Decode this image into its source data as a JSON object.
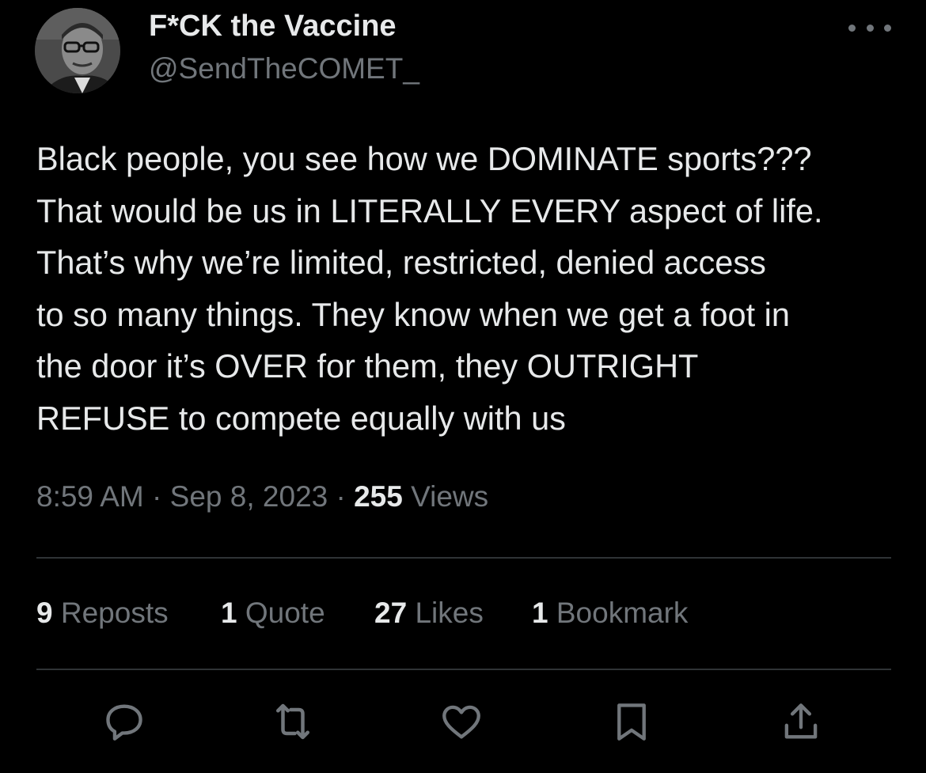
{
  "author": {
    "display_name": "F*CK the Vaccine",
    "handle": "@SendTheCOMET_"
  },
  "tweet": {
    "lines": [
      "Black people, you see how we DOMINATE sports???",
      "That would be us in LITERALLY EVERY aspect of life.",
      "That’s why we’re limited, restricted, denied access",
      "to so many things. They know when we get a foot in",
      "the door it’s OVER for them, they OUTRIGHT",
      "REFUSE to compete equally with us"
    ]
  },
  "meta": {
    "time": "8:59 AM",
    "separator": "·",
    "date": "Sep 8, 2023",
    "views_count": "255",
    "views_label": "Views"
  },
  "stats": {
    "reposts_count": "9",
    "reposts_label": "Reposts",
    "quotes_count": "1",
    "quotes_label": "Quote",
    "likes_count": "27",
    "likes_label": "Likes",
    "bookmarks_count": "1",
    "bookmarks_label": "Bookmark"
  },
  "icons": {
    "more": "more-horizontal-icon",
    "reply": "reply-icon",
    "repost": "repost-icon",
    "like": "like-icon",
    "bookmark": "bookmark-icon",
    "share": "share-icon"
  },
  "colors": {
    "background": "#000000",
    "text_primary": "#e7e9ea",
    "text_secondary": "#71767b",
    "divider": "#2f3336"
  }
}
